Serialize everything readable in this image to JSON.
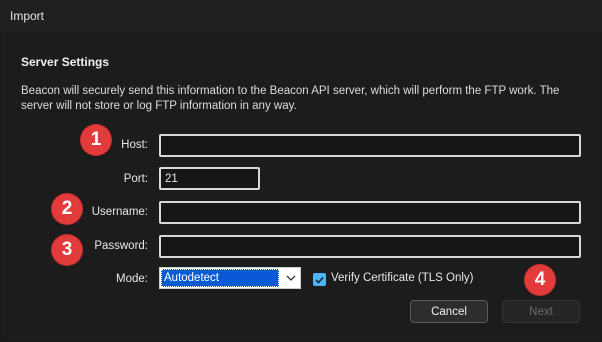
{
  "window": {
    "title": "Import"
  },
  "section": {
    "heading": "Server Settings",
    "description": "Beacon will securely send this information to the Beacon API server, which will perform the FTP work. The server will not store or log FTP information in any way."
  },
  "form": {
    "host": {
      "label": "Host:",
      "value": ""
    },
    "port": {
      "label": "Port:",
      "value": "21"
    },
    "username": {
      "label": "Username:",
      "value": ""
    },
    "password": {
      "label": "Password:",
      "value": ""
    },
    "mode": {
      "label": "Mode:",
      "value": "Autodetect"
    },
    "verify_certificate": {
      "label": "Verify Certificate (TLS Only)",
      "checked": true
    }
  },
  "buttons": {
    "cancel": "Cancel",
    "next": "Next"
  },
  "annotations": {
    "badge1": "1",
    "badge2": "2",
    "badge3": "3",
    "badge4": "4"
  },
  "colors": {
    "badge": "#e23b3b",
    "selection": "#0a5ad8",
    "checkbox": "#4db3f5"
  }
}
